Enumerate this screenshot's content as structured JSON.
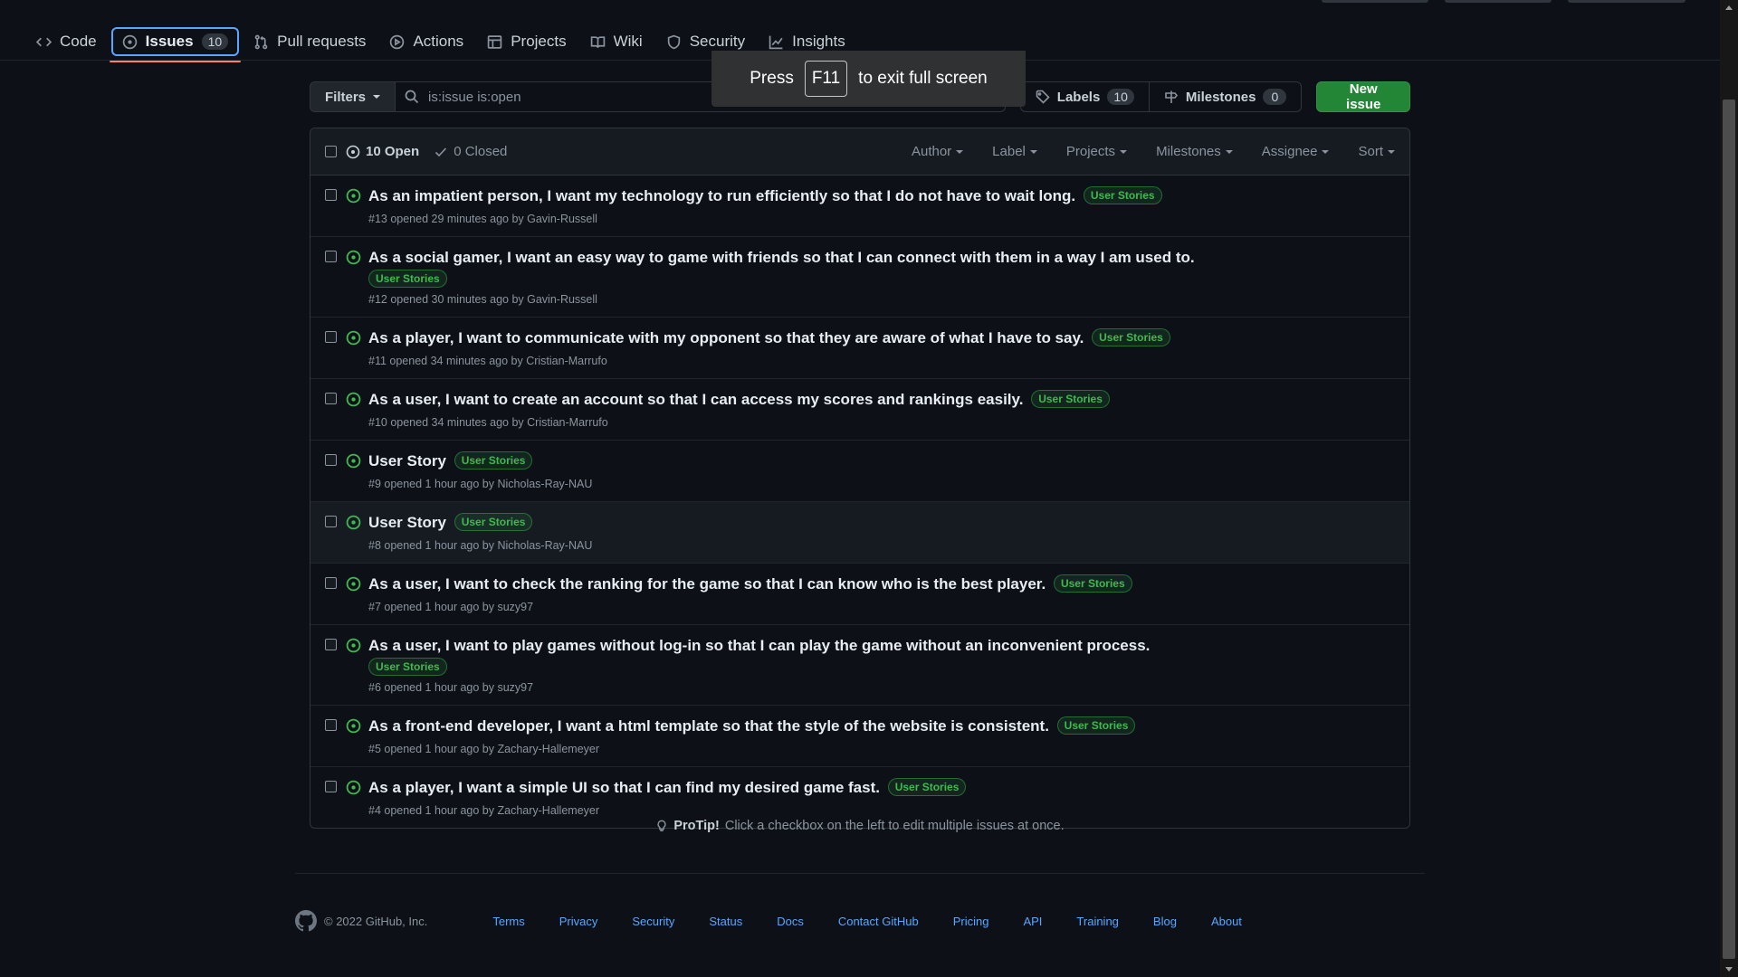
{
  "repo_nav": {
    "items": [
      {
        "label": "Code",
        "icon": "code-icon"
      },
      {
        "label": "Issues",
        "icon": "issue-opened-icon",
        "count": "10",
        "selected": true
      },
      {
        "label": "Pull requests",
        "icon": "git-pull-request-icon"
      },
      {
        "label": "Actions",
        "icon": "play-icon"
      },
      {
        "label": "Projects",
        "icon": "table-icon"
      },
      {
        "label": "Wiki",
        "icon": "book-icon"
      },
      {
        "label": "Security",
        "icon": "shield-icon"
      },
      {
        "label": "Insights",
        "icon": "graph-icon"
      }
    ]
  },
  "toolbar": {
    "filters_label": "Filters",
    "search_value": "is:issue is:open",
    "labels_label": "Labels",
    "labels_count": "10",
    "milestones_label": "Milestones",
    "milestones_count": "0",
    "new_issue_label": "New issue"
  },
  "fullscreen_toast": {
    "prefix": "Press",
    "key": "F11",
    "suffix": "to exit full screen"
  },
  "issues_header": {
    "open_label": "10 Open",
    "closed_label": "0 Closed",
    "filters": [
      "Author",
      "Label",
      "Projects",
      "Milestones",
      "Assignee",
      "Sort"
    ]
  },
  "issues": [
    {
      "title": "As an impatient person, I want my technology to run efficiently so that I do not have to wait long.",
      "label": "User Stories",
      "meta": "#13 opened 29 minutes ago by Gavin-Russell"
    },
    {
      "title": "As a social gamer, I want an easy way to game with friends so that I can connect with them in a way I am used to.",
      "label": "User Stories",
      "meta": "#12 opened 30 minutes ago by Gavin-Russell"
    },
    {
      "title": "As a player, I want to communicate with my opponent so that they are aware of what I have to say.",
      "label": "User Stories",
      "meta": "#11 opened 34 minutes ago by Cristian-Marrufo"
    },
    {
      "title": "As a user, I want to create an account so that I can access my scores and rankings easily.",
      "label": "User Stories",
      "meta": "#10 opened 34 minutes ago by Cristian-Marrufo"
    },
    {
      "title": "User Story",
      "label": "User Stories",
      "meta": "#9 opened 1 hour ago by Nicholas-Ray-NAU"
    },
    {
      "title": "User Story",
      "label": "User Stories",
      "meta": "#8 opened 1 hour ago by Nicholas-Ray-NAU"
    },
    {
      "title": "As a user, I want to check the ranking for the game so that I can know who is the best player.",
      "label": "User Stories",
      "meta": "#7 opened 1 hour ago by suzy97"
    },
    {
      "title": "As a user, I want to play games without log-in so that I can play the game without an inconvenient process.",
      "label": "User Stories",
      "meta": "#6 opened 1 hour ago by suzy97"
    },
    {
      "title": "As a front-end developer, I want a html template so that the style of the website is consistent.",
      "label": "User Stories",
      "meta": "#5 opened 1 hour ago by Zachary-Hallemeyer"
    },
    {
      "title": "As a player, I want a simple UI so that I can find my desired game fast.",
      "label": "User Stories",
      "meta": "#4 opened 1 hour ago by Zachary-Hallemeyer"
    }
  ],
  "protip": {
    "strong": "ProTip!",
    "text": "Click a checkbox on the left to edit multiple issues at once."
  },
  "footer": {
    "copyright": "© 2022 GitHub, Inc.",
    "links": [
      "Terms",
      "Privacy",
      "Security",
      "Status",
      "Docs",
      "Contact GitHub",
      "Pricing",
      "API",
      "Training",
      "Blog",
      "About"
    ]
  },
  "colors": {
    "background": "#0d1117",
    "accent_blue": "#58a6ff",
    "open_green": "#3fb950",
    "button_green": "#238636",
    "selected_underline": "#f78166"
  }
}
